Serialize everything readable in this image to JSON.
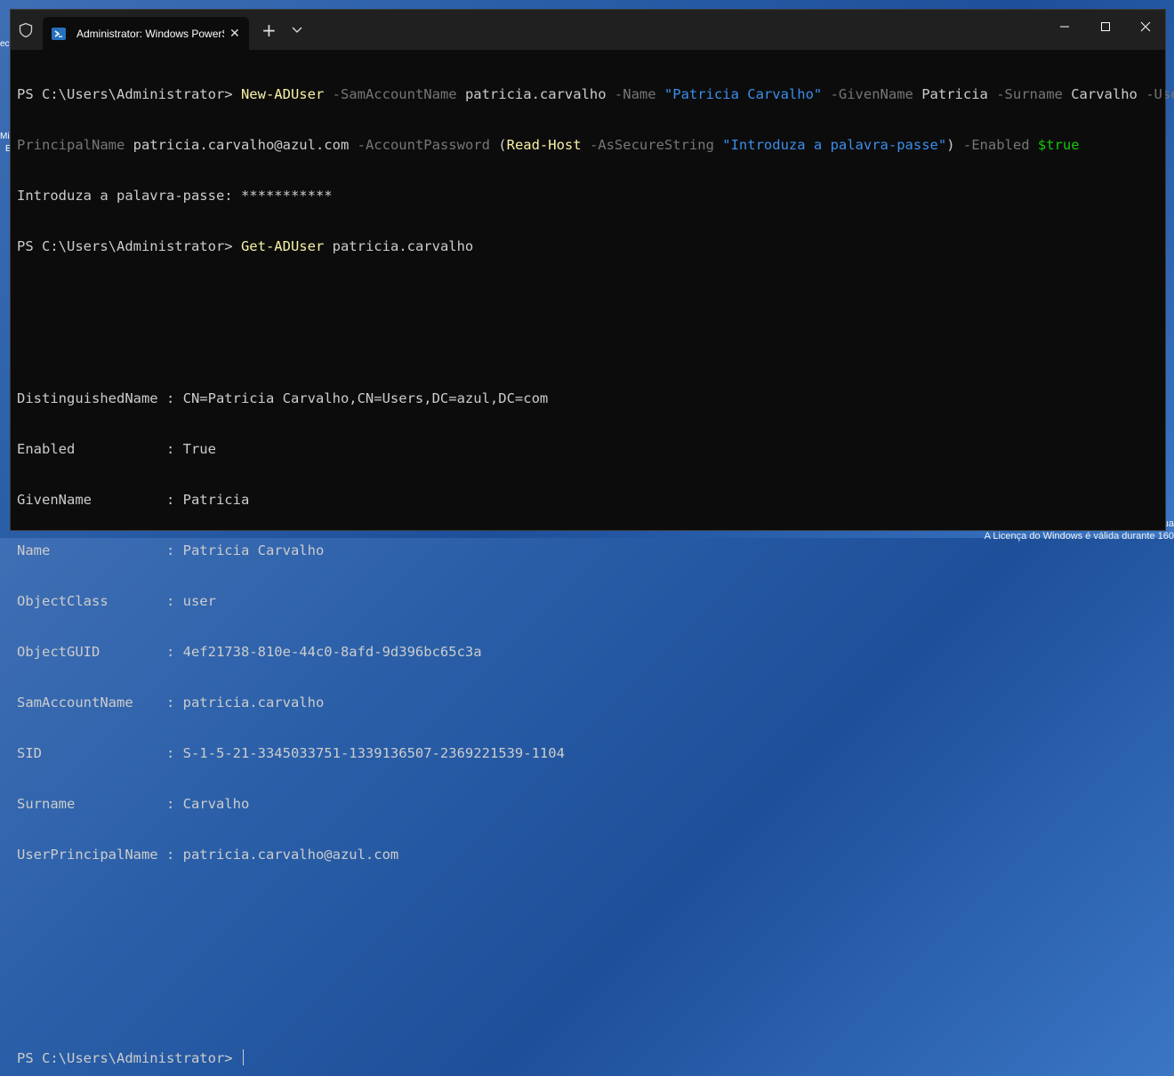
{
  "window": {
    "tab_title": "Administrator: Windows PowerShell",
    "new_tab": "+",
    "tab_close": "✕"
  },
  "terminal": {
    "prompt": "PS C:\\Users\\Administrator> ",
    "cmd1": {
      "cmdlet": "New-ADUser",
      "p1": " -SamAccountName",
      "v1": " patricia.carvalho",
      "p2": " -Name",
      "v2": " \"Patricia Carvalho\"",
      "p3": " -GivenName",
      "v3": " Patricia",
      "p4": " -Surname",
      "v4": " Carvalho",
      "p5a": " -User",
      "p5b": "PrincipalName",
      "v5": " patricia.carvalho@azul.com",
      "p6": " -AccountPassword",
      "v6a": " (",
      "v6cmd": "Read-Host",
      "v6p": " -AsSecureString",
      "v6s": " \"Introduza a palavra-passe\"",
      "v6b": ")",
      "p7": " -Enabled",
      "v7": " $true"
    },
    "password_prompt": "Introduza a palavra-passe: ***********",
    "cmd2": {
      "cmdlet": "Get-ADUser",
      "arg": " patricia.carvalho"
    },
    "output": [
      "DistinguishedName : CN=Patricia Carvalho,CN=Users,DC=azul,DC=com",
      "Enabled           : True",
      "GivenName         : Patricia",
      "Name              : Patricia Carvalho",
      "ObjectClass       : user",
      "ObjectGUID        : 4ef21738-810e-44c0-8afd-9d396bc65c3a",
      "SamAccountName    : patricia.carvalho",
      "SID               : S-1-5-21-3345033751-1339136507-2369221539-1104",
      "Surname           : Carvalho",
      "UserPrincipalName : patricia.carvalho@azul.com"
    ],
    "final_prompt": "PS C:\\Users\\Administrator> "
  },
  "desktop": {
    "watermark": "A Licença do Windows é válida durante 160",
    "watermark_top": "ua",
    "icon_text1": "ec",
    "icon_text2": "Mi",
    "icon_text3": "E"
  },
  "colors": {
    "terminal_bg": "#0c0c0c",
    "cmdlet": "#f9f1a5",
    "parameter": "#767676",
    "string": "#3b8eea",
    "variable": "#16c60c"
  }
}
